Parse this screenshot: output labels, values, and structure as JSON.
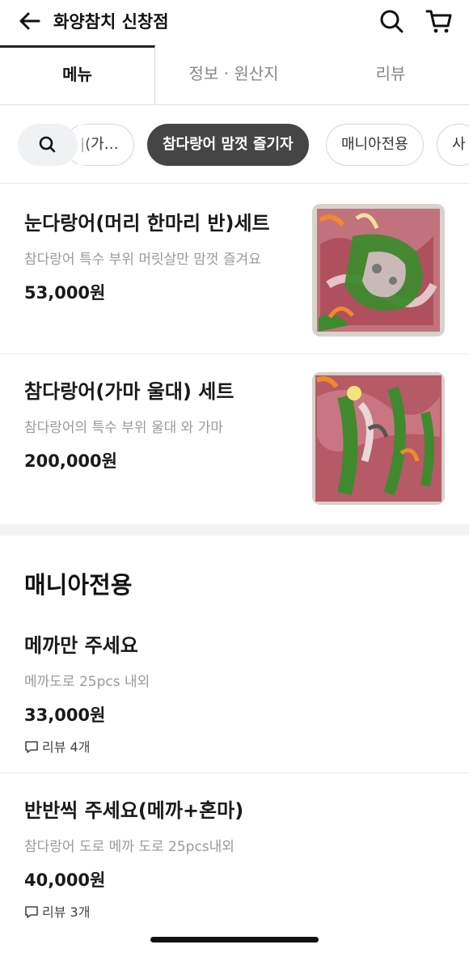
{
  "header": {
    "title": "화양참치 신창점",
    "back_icon": "arrow-left-icon",
    "search_icon": "search-icon",
    "cart_icon": "cart-icon"
  },
  "tabs": [
    {
      "label": "메뉴",
      "active": true
    },
    {
      "label": "정보 · 원산지",
      "active": false
    },
    {
      "label": "리뷰",
      "active": false
    }
  ],
  "chips": {
    "search_icon": "search-icon",
    "items": [
      {
        "label": "|(가…",
        "active": false
      },
      {
        "label": "참다랑어 맘껏 즐기자",
        "active": true
      },
      {
        "label": "매니아전용",
        "active": false
      },
      {
        "label": "사",
        "active": false
      }
    ]
  },
  "menu_items": [
    {
      "name": "눈다랑어(머리 한마리 반)세트",
      "desc": "참다랑어 특수 부위 머릿살만 맘껏 즐겨요",
      "price": "53,000원"
    },
    {
      "name": "참다랑어(가마 울대) 세트",
      "desc": "참다랑어의 특수 부위 울대 와 가마",
      "price": "200,000원"
    }
  ],
  "section": {
    "title": "매니아전용"
  },
  "mania_items": [
    {
      "name": "메까만 주세요",
      "desc": "메까도로 25pcs 내외",
      "price": "33,000원",
      "review": "리뷰 4개"
    },
    {
      "name": "반반씩 주세요(메까+혼마)",
      "desc": "참다랑어 도로 메까 도로 25pcs내외",
      "price": "40,000원",
      "review": "리뷰 3개"
    }
  ],
  "colors": {
    "chip_active": "#454545",
    "text_muted": "#9a9a9a",
    "divider": "#f2f3f5"
  }
}
